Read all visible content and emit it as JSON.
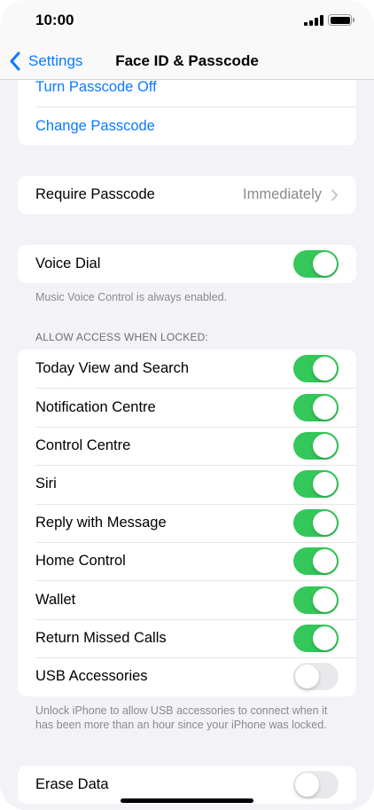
{
  "status_bar": {
    "time": "10:00"
  },
  "nav": {
    "back_label": "Settings",
    "title": "Face ID & Passcode"
  },
  "passcode_group": {
    "turn_off": "Turn Passcode Off",
    "change": "Change Passcode"
  },
  "require_passcode": {
    "label": "Require Passcode",
    "value": "Immediately"
  },
  "voice_dial": {
    "label": "Voice Dial",
    "on": true,
    "footnote": "Music Voice Control is always enabled."
  },
  "locked_access": {
    "header": "ALLOW ACCESS WHEN LOCKED:",
    "items": [
      {
        "label": "Today View and Search",
        "on": true
      },
      {
        "label": "Notification Centre",
        "on": true
      },
      {
        "label": "Control Centre",
        "on": true
      },
      {
        "label": "Siri",
        "on": true
      },
      {
        "label": "Reply with Message",
        "on": true
      },
      {
        "label": "Home Control",
        "on": true
      },
      {
        "label": "Wallet",
        "on": true
      },
      {
        "label": "Return Missed Calls",
        "on": true
      },
      {
        "label": "USB Accessories",
        "on": false
      }
    ],
    "footnote": "Unlock iPhone to allow USB accessories to connect when it has been more than an hour since your iPhone was locked."
  },
  "erase_data": {
    "label": "Erase Data",
    "on": false
  },
  "colors": {
    "accent": "#0a7aff",
    "toggle_on": "#34c759",
    "toggle_off": "#e9e9eb"
  }
}
